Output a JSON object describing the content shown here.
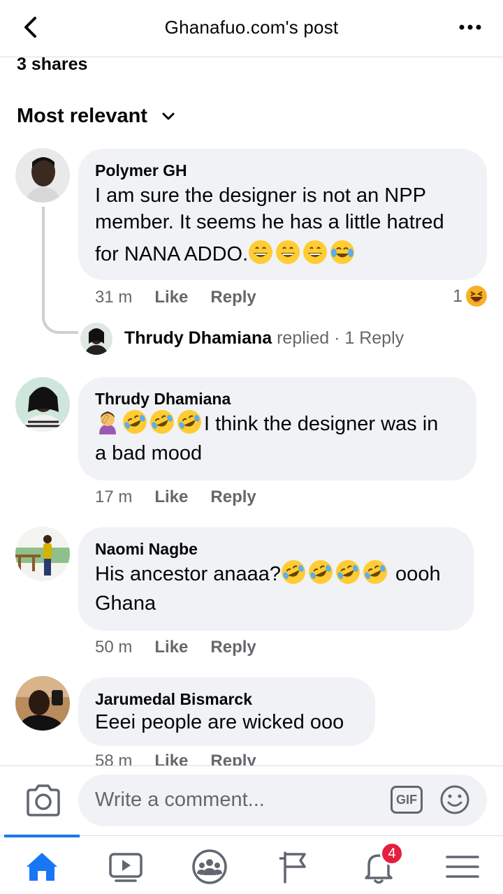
{
  "header": {
    "title": "Ghanafuo.com's post"
  },
  "shares": "3 shares",
  "sort_label": "Most relevant",
  "comments": [
    {
      "author": "Polymer GH",
      "lines": [
        "I am sure the designer is not an NPP",
        "member. It seems he has a little hatred",
        "for NANA ADDO."
      ],
      "time": "31 m",
      "like": "Like",
      "reply": "Reply",
      "reaction_count": "1",
      "reply_author": "Thrudy Dhamiana",
      "reply_rest": " replied · 1 Reply"
    },
    {
      "author": "Thrudy Dhamiana",
      "line1": "I think the designer was in",
      "line2": "a bad mood",
      "time": "17 m",
      "like": "Like",
      "reply": "Reply"
    },
    {
      "author": "Naomi Nagbe",
      "line1a": "His ancestor anaaa?",
      "line1b": " oooh",
      "line2": "Ghana",
      "time": "50 m",
      "like": "Like",
      "reply": "Reply"
    },
    {
      "author": "Jarumedal Bismarck",
      "text": "Eeei people are wicked ooo",
      "time": "58 m",
      "like": "Like",
      "reply": "Reply"
    }
  ],
  "composer": {
    "placeholder": "Write a comment...",
    "gif_label": "GIF"
  },
  "nav": {
    "notifications_badge": "4"
  },
  "colors": {
    "accent": "#1877f2",
    "bubble": "#f0f2f5",
    "muted": "#65676b",
    "badge": "#e41e3f"
  }
}
